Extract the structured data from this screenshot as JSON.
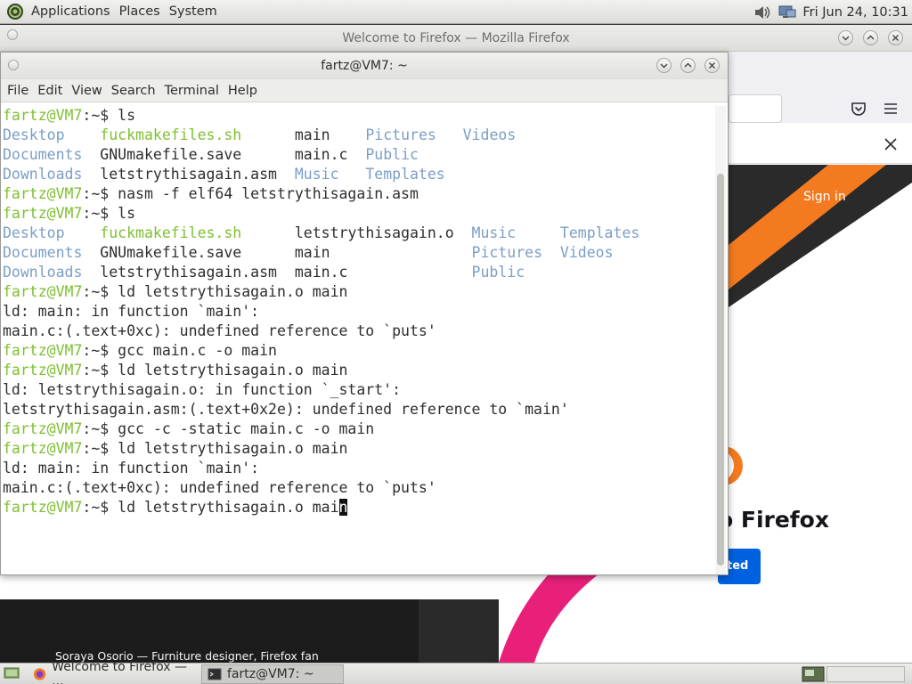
{
  "top_panel": {
    "menus": [
      "Applications",
      "Places",
      "System"
    ],
    "clock": "Fri Jun 24, 10:31"
  },
  "firefox": {
    "title": "Welcome to Firefox — Mozilla Firefox",
    "sign_in": "Sign in",
    "heading": "o Firefox",
    "cta": "ted",
    "caption": "Soraya Osorio — Furniture designer, Firefox fan"
  },
  "terminal": {
    "title": "fartz@VM7: ~",
    "menu": [
      "File",
      "Edit",
      "View",
      "Search",
      "Terminal",
      "Help"
    ],
    "prompt": "fartz@VM7",
    "prompt_suffix": ":~$ ",
    "commands": [
      "ls",
      "nasm -f elf64 letstrythisagain.asm",
      "ls",
      "ld letstrythisagain.o main",
      "gcc main.c -o main",
      "ld letstrythisagain.o main",
      "gcc -c -static main.c -o main",
      "ld letstrythisagain.o main",
      "ld letstrythisagain.o mai"
    ],
    "cursor_char": "n",
    "ls1": {
      "c1": [
        "Desktop",
        "Documents",
        "Downloads"
      ],
      "c2": [
        "fuckmakefiles.sh",
        "GNUmakefile.save",
        "letstrythisagain.asm"
      ],
      "c3": [
        "main",
        "main.c",
        "Music"
      ],
      "c4": [
        "Pictures",
        "Public",
        "Templates"
      ],
      "c5": [
        "Videos"
      ]
    },
    "ls2": {
      "c1": [
        "Desktop",
        "Documents",
        "Downloads"
      ],
      "c2": [
        "fuckmakefiles.sh",
        "GNUmakefile.save",
        "letstrythisagain.asm"
      ],
      "c3": [
        "letstrythisagain.o",
        "main",
        "main.c"
      ],
      "c4": [
        "Music",
        "Pictures",
        "Public"
      ],
      "c5": [
        "Templates",
        "Videos"
      ]
    },
    "errors": [
      "ld: main: in function `main':",
      "main.c:(.text+0xc): undefined reference to `puts'",
      "ld: letstrythisagain.o: in function `_start':",
      "letstrythisagain.asm:(.text+0x2e): undefined reference to `main'",
      "ld: main: in function `main':",
      "main.c:(.text+0xc): undefined reference to `puts'"
    ]
  },
  "taskbar": {
    "items": [
      "Welcome to Firefox — ...",
      "fartz@VM7: ~"
    ]
  },
  "colors": {
    "prompt": "#7ec031",
    "directory": "#7a9ec7",
    "executable": "#7ec031",
    "firefox_cta": "#0061e0",
    "hero_pink": "#e8207a"
  }
}
